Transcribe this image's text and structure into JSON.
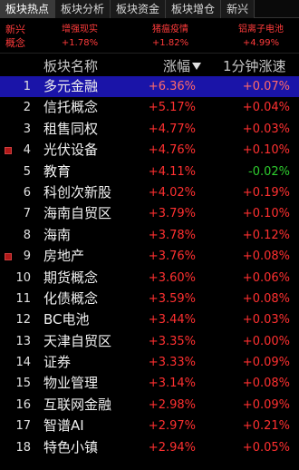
{
  "tabs": [
    "板块热点",
    "板块分析",
    "板块资金",
    "板块增仓",
    "新兴"
  ],
  "hot": {
    "label": "新兴\n概念",
    "items": [
      {
        "name": "增强现实",
        "pct": "+1.78%"
      },
      {
        "name": "猪瘟疫情",
        "pct": "+1.82%"
      },
      {
        "name": "铝离子电池",
        "pct": "+4.99%"
      }
    ]
  },
  "header": {
    "name": "板块名称",
    "change": "涨幅",
    "speed": "1分钟涨速"
  },
  "rows": [
    {
      "no": "1",
      "name": "多元金融",
      "pct": "+6.36%",
      "spd": "+0.07%",
      "marked": false,
      "selected": true,
      "down": false
    },
    {
      "no": "2",
      "name": "信托概念",
      "pct": "+5.17%",
      "spd": "+0.04%",
      "marked": false,
      "selected": false,
      "down": false
    },
    {
      "no": "3",
      "name": "租售同权",
      "pct": "+4.77%",
      "spd": "+0.03%",
      "marked": false,
      "selected": false,
      "down": false
    },
    {
      "no": "4",
      "name": "光伏设备",
      "pct": "+4.76%",
      "spd": "+0.10%",
      "marked": true,
      "selected": false,
      "down": false
    },
    {
      "no": "5",
      "name": "教育",
      "pct": "+4.11%",
      "spd": "-0.02%",
      "marked": false,
      "selected": false,
      "down": true
    },
    {
      "no": "6",
      "name": "科创次新股",
      "pct": "+4.02%",
      "spd": "+0.19%",
      "marked": false,
      "selected": false,
      "down": false
    },
    {
      "no": "7",
      "name": "海南自贸区",
      "pct": "+3.79%",
      "spd": "+0.10%",
      "marked": false,
      "selected": false,
      "down": false
    },
    {
      "no": "8",
      "name": "海南",
      "pct": "+3.78%",
      "spd": "+0.12%",
      "marked": false,
      "selected": false,
      "down": false
    },
    {
      "no": "9",
      "name": "房地产",
      "pct": "+3.76%",
      "spd": "+0.08%",
      "marked": true,
      "selected": false,
      "down": false
    },
    {
      "no": "10",
      "name": "期货概念",
      "pct": "+3.60%",
      "spd": "+0.06%",
      "marked": false,
      "selected": false,
      "down": false
    },
    {
      "no": "11",
      "name": "化债概念",
      "pct": "+3.59%",
      "spd": "+0.08%",
      "marked": false,
      "selected": false,
      "down": false
    },
    {
      "no": "12",
      "name": "BC电池",
      "pct": "+3.44%",
      "spd": "+0.03%",
      "marked": false,
      "selected": false,
      "down": false
    },
    {
      "no": "13",
      "name": "天津自贸区",
      "pct": "+3.35%",
      "spd": "+0.00%",
      "marked": false,
      "selected": false,
      "down": false
    },
    {
      "no": "14",
      "name": "证券",
      "pct": "+3.33%",
      "spd": "+0.09%",
      "marked": false,
      "selected": false,
      "down": false
    },
    {
      "no": "15",
      "name": "物业管理",
      "pct": "+3.14%",
      "spd": "+0.08%",
      "marked": false,
      "selected": false,
      "down": false
    },
    {
      "no": "16",
      "name": "互联网金融",
      "pct": "+2.98%",
      "spd": "+0.09%",
      "marked": false,
      "selected": false,
      "down": false
    },
    {
      "no": "17",
      "name": "智谱AI",
      "pct": "+2.97%",
      "spd": "+0.21%",
      "marked": false,
      "selected": false,
      "down": false
    },
    {
      "no": "18",
      "name": "特色小镇",
      "pct": "+2.94%",
      "spd": "+0.05%",
      "marked": false,
      "selected": false,
      "down": false
    }
  ]
}
